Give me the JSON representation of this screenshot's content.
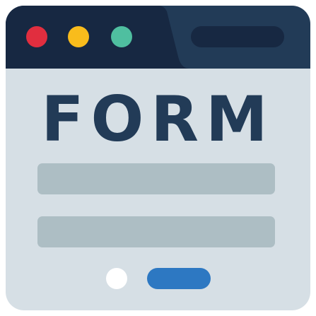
{
  "heading": {
    "text": "FORM"
  },
  "colors": {
    "window_body": "#d6dfe5",
    "titlebar_light": "#223b57",
    "titlebar_dark": "#172842",
    "address_bar": "#172842",
    "close_dot": "#e12e3f",
    "minimize_dot": "#f9bc1c",
    "maximize_dot": "#4fbfa0",
    "heading_text": "#223b57",
    "field": "#adbec4",
    "radio_dot": "#ffffff",
    "submit_button": "#2d78c2"
  },
  "icons": {
    "close": "red-circle",
    "minimize": "yellow-circle",
    "maximize": "green-circle"
  }
}
